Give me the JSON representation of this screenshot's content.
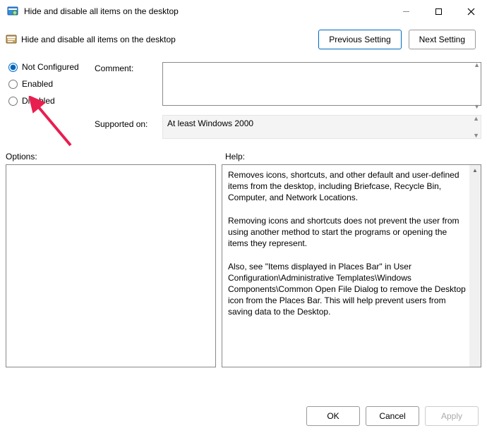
{
  "window": {
    "title": "Hide and disable all items on the desktop"
  },
  "header": {
    "setting_name": "Hide and disable all items on the desktop",
    "prev_btn": "Previous Setting",
    "next_btn": "Next Setting"
  },
  "state": {
    "not_configured": "Not Configured",
    "enabled": "Enabled",
    "disabled": "Disabled",
    "selected": "not_configured"
  },
  "labels": {
    "comment": "Comment:",
    "supported": "Supported on:",
    "options": "Options:",
    "help": "Help:"
  },
  "fields": {
    "comment_value": "",
    "supported_value": "At least Windows 2000"
  },
  "help": {
    "p1": "Removes icons, shortcuts, and other default and user-defined items from the desktop, including Briefcase, Recycle Bin, Computer, and Network Locations.",
    "p2": "Removing icons and shortcuts does not prevent the user from using another method to start the programs or opening the items they represent.",
    "p3": "Also, see \"Items displayed in Places Bar\" in User Configuration\\Administrative Templates\\Windows Components\\Common Open File Dialog to remove the Desktop icon from the Places Bar. This will help prevent users from saving data to the Desktop."
  },
  "footer": {
    "ok": "OK",
    "cancel": "Cancel",
    "apply": "Apply"
  }
}
